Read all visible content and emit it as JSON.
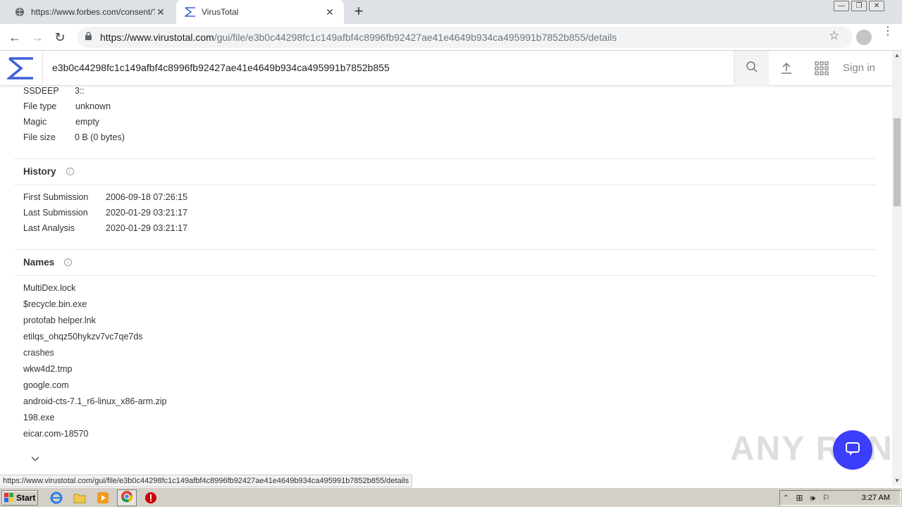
{
  "tabs": [
    {
      "title": "https://www.forbes.com/consent/?t",
      "active": false
    },
    {
      "title": "VirusTotal",
      "active": true
    }
  ],
  "address": {
    "host": "https://www.virustotal.com",
    "path": "/gui/file/e3b0c44298fc1c149afbf4c8996fb92427ae41e4649b934ca495991b7852b855/details"
  },
  "vt": {
    "search_value": "e3b0c44298fc1c149afbf4c8996fb92427ae41e4649b934ca495991b7852b855",
    "signin_label": "Sign in"
  },
  "basic": [
    {
      "key": "SSDEEP",
      "value": "3::"
    },
    {
      "key": "File type",
      "value": "unknown"
    },
    {
      "key": "Magic",
      "value": "empty"
    },
    {
      "key": "File size",
      "value": "0 B (0 bytes)"
    }
  ],
  "history": {
    "title": "History",
    "rows": [
      {
        "key": "First Submission",
        "value": "2006-09-18 07:26:15"
      },
      {
        "key": "Last Submission",
        "value": "2020-01-29 03:21:17"
      },
      {
        "key": "Last Analysis",
        "value": "2020-01-29 03:21:17"
      }
    ]
  },
  "names": {
    "title": "Names",
    "items": [
      "MultiDex.lock",
      "$recycle.bin.exe",
      "protofab helper.lnk",
      "etilqs_ohqz50hykzv7vc7qe7ds",
      "crashes",
      "wkw4d2.tmp",
      "google.com",
      "android-cts-7.1_r6-linux_x86-arm.zip",
      "198.exe",
      "eicar.com-18570"
    ]
  },
  "status_url": "https://www.virustotal.com/gui/file/e3b0c44298fc1c149afbf4c8996fb92427ae41e4649b934ca495991b7852b855/details",
  "watermark": "ANY RUN",
  "taskbar": {
    "start_label": "Start",
    "clock": "3:27 AM"
  },
  "colors": {
    "vt_blue": "#3b61d9",
    "fab": "#3d3dfc"
  }
}
